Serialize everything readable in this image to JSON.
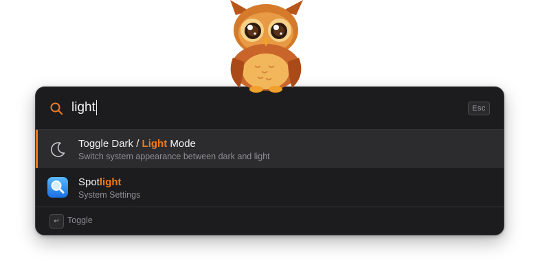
{
  "search": {
    "query": "light",
    "esc_label": "Esc"
  },
  "results": [
    {
      "title_before": "Toggle Dark / ",
      "title_match": "Light",
      "title_after": " Mode",
      "subtitle": "Switch system appearance between dark and light",
      "icon": "moon-icon",
      "selected": true
    },
    {
      "title_before": "Spot",
      "title_match": "light",
      "title_after": "",
      "subtitle": "System Settings",
      "icon": "spotlight-app-icon",
      "selected": false
    }
  ],
  "footer": {
    "enter_glyph": "↵",
    "action_label": "Toggle"
  },
  "colors": {
    "accent": "#f07a1a",
    "panel_bg": "#1c1c1e",
    "selected_bg": "#2c2c2e"
  }
}
